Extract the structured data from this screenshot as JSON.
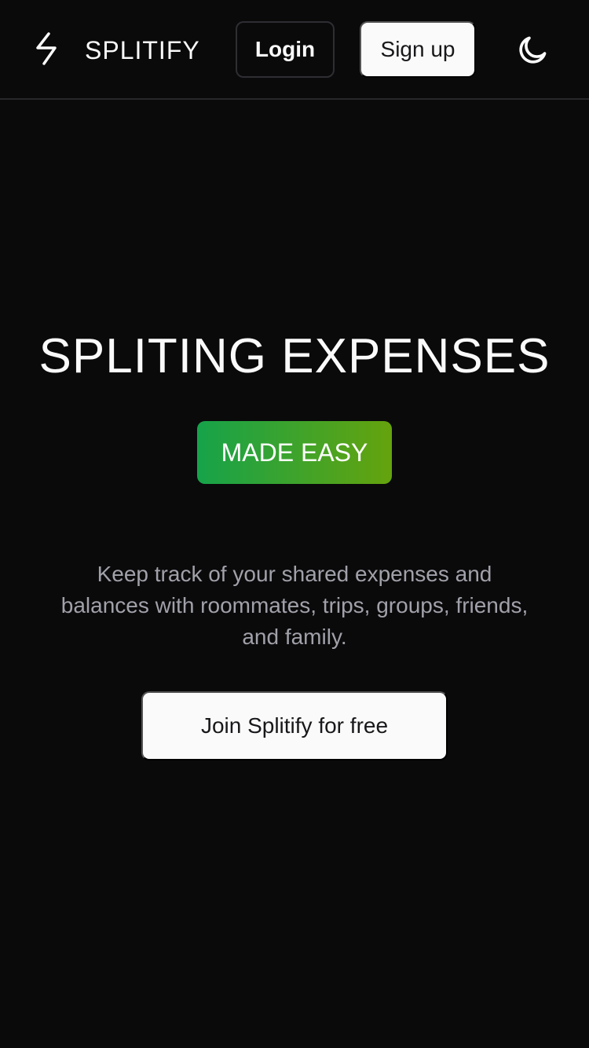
{
  "header": {
    "brand_name": "SPLITIFY",
    "login_label": "Login",
    "signup_label": "Sign up",
    "logo_icon": "bolt-icon",
    "theme_icon": "moon-icon"
  },
  "hero": {
    "title": "SPLITING EXPENSES",
    "badge": "MADE EASY",
    "description": "Keep track of your shared expenses and balances with roommates, trips, groups, friends, and family.",
    "cta_label": "Join Splitify for free"
  },
  "colors": {
    "background": "#0a0a0b",
    "badge_gradient_start": "#16a34a",
    "badge_gradient_end": "#65a30d",
    "button_light": "#fafafa",
    "muted_text": "#a1a1aa"
  }
}
